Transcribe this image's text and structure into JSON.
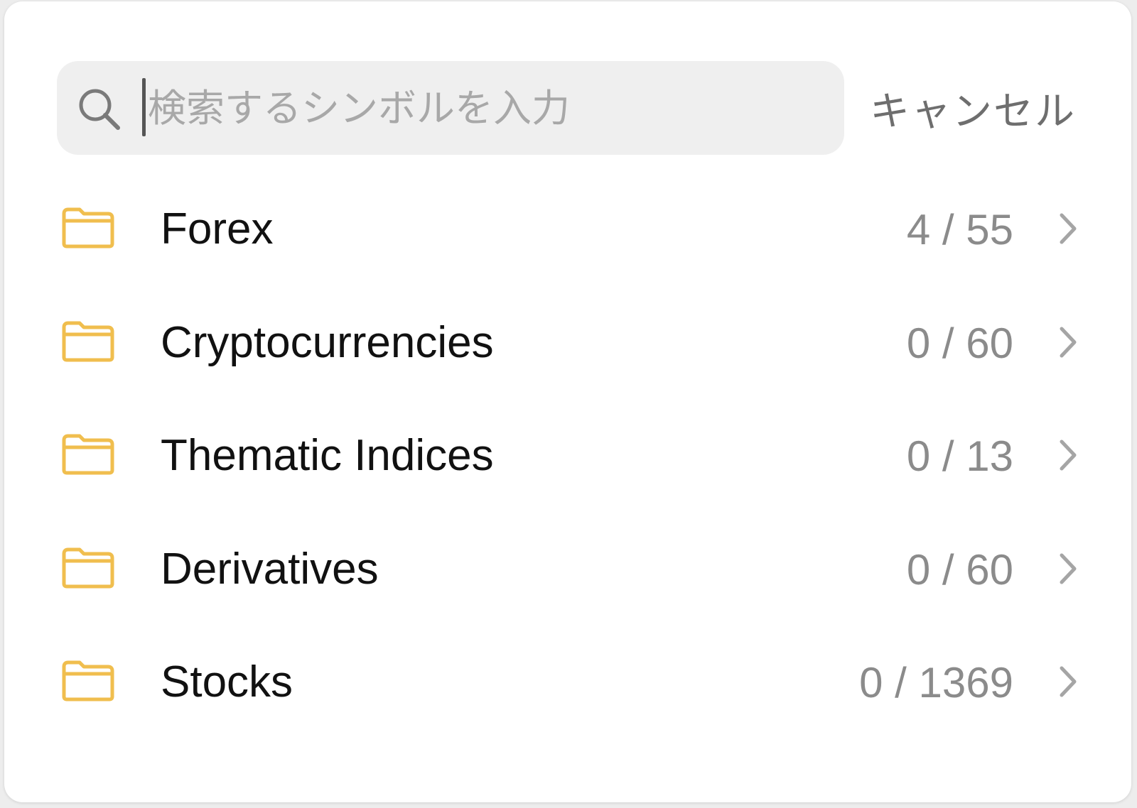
{
  "search": {
    "placeholder": "検索するシンボルを入力",
    "value": "",
    "icon": "search-icon"
  },
  "cancel_label": "キャンセル",
  "colors": {
    "folder": "#F0BE4E",
    "count": "#8B8B8B",
    "label": "#111111",
    "search_bg": "#EFEFEF"
  },
  "categories": [
    {
      "label": "Forex",
      "count": "4 / 55",
      "icon": "folder-icon"
    },
    {
      "label": "Cryptocurrencies",
      "count": "0 / 60",
      "icon": "folder-icon"
    },
    {
      "label": "Thematic Indices",
      "count": "0 / 13",
      "icon": "folder-icon"
    },
    {
      "label": "Derivatives",
      "count": "0 / 60",
      "icon": "folder-icon"
    },
    {
      "label": "Stocks",
      "count": "0 / 1369",
      "icon": "folder-icon"
    }
  ]
}
